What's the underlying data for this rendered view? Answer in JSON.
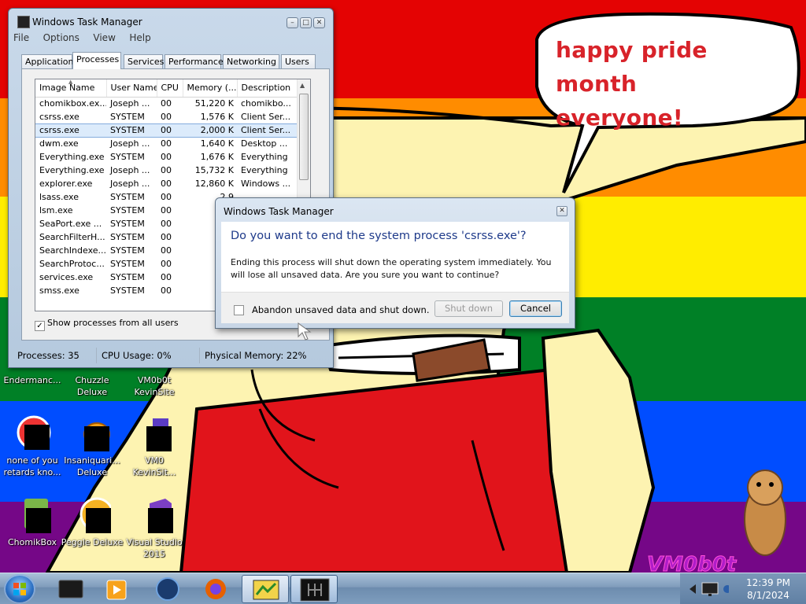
{
  "wallpaper": {
    "speech_bubble": [
      "happy pride month",
      "everyone!"
    ],
    "signature_logo": "VM0b0t",
    "stripe_colors": [
      "#e40303",
      "#ff8c00",
      "#ffed00",
      "#008026",
      "#004dff",
      "#750787"
    ]
  },
  "desktop_icons": [
    {
      "label": "Endermanc...",
      "icon": "app-icon"
    },
    {
      "label": "Chuzzle\nDeluxe",
      "icon": "chuzzle-icon"
    },
    {
      "label": "VM0b0t\nKevinSite",
      "icon": "app-icon"
    },
    {
      "label": "none of you\nretards kno...",
      "icon": "app-icon"
    },
    {
      "label": "Insaniquari...\nDeluxe",
      "icon": "insaniquarium-icon"
    },
    {
      "label": "VM0\nKevinSit...",
      "icon": "app-icon"
    },
    {
      "label": "ChomikBox",
      "icon": "chomikbox-icon"
    },
    {
      "label": "Peggle Deluxe",
      "icon": "peggle-icon"
    },
    {
      "label": "Visual Studio\n2015",
      "icon": "visual-studio-icon"
    }
  ],
  "task_manager": {
    "title": "Windows Task Manager",
    "menu": [
      "File",
      "Options",
      "View",
      "Help"
    ],
    "tabs": [
      "Applications",
      "Processes",
      "Services",
      "Performance",
      "Networking",
      "Users"
    ],
    "selected_tab": "Processes",
    "columns": [
      "Image Name",
      "User Name",
      "CPU",
      "Memory (...",
      "Description"
    ],
    "rows": [
      [
        "chomikbox.ex...",
        "Joseph ...",
        "00",
        "51,220 K",
        "chomikbo..."
      ],
      [
        "csrss.exe",
        "SYSTEM",
        "00",
        "1,576 K",
        "Client Ser..."
      ],
      [
        "csrss.exe",
        "SYSTEM",
        "00",
        "2,000 K",
        "Client Ser..."
      ],
      [
        "dwm.exe",
        "Joseph ...",
        "00",
        "1,640 K",
        "Desktop ..."
      ],
      [
        "Everything.exe",
        "SYSTEM",
        "00",
        "1,676 K",
        "Everything"
      ],
      [
        "Everything.exe",
        "Joseph ...",
        "00",
        "15,732 K",
        "Everything"
      ],
      [
        "explorer.exe",
        "Joseph ...",
        "00",
        "12,860 K",
        "Windows ..."
      ],
      [
        "lsass.exe",
        "SYSTEM",
        "00",
        "2,9",
        ""
      ],
      [
        "lsm.exe",
        "SYSTEM",
        "00",
        "1,7",
        ""
      ],
      [
        "SeaPort.exe ...",
        "SYSTEM",
        "00",
        "5,2",
        ""
      ],
      [
        "SearchFilterH...",
        "SYSTEM",
        "00",
        "2,6",
        ""
      ],
      [
        "SearchIndexe...",
        "SYSTEM",
        "00",
        "6,9",
        ""
      ],
      [
        "SearchProtoc...",
        "SYSTEM",
        "00",
        "2,3",
        ""
      ],
      [
        "services.exe",
        "SYSTEM",
        "00",
        "3,5",
        ""
      ],
      [
        "smss.exe",
        "SYSTEM",
        "00",
        "5",
        ""
      ]
    ],
    "selected_row": 2,
    "show_all_label": "Show processes from all users",
    "show_all_checked": true,
    "status": {
      "processes": "Processes: 35",
      "cpu": "CPU Usage: 0%",
      "memory": "Physical Memory: 22%"
    }
  },
  "dialog": {
    "title": "Windows Task Manager",
    "heading": "Do you want to end the system process 'csrss.exe'?",
    "message": "Ending this process will shut down the operating system immediately.  You will lose all unsaved data.  Are you sure you want to continue?",
    "checkbox_label": "Abandon unsaved data and shut down.",
    "checkbox_checked": false,
    "shutdown_label": "Shut down",
    "shutdown_enabled": false,
    "cancel_label": "Cancel"
  },
  "taskbar": {
    "pinned": [
      "start-orb",
      "terminal-icon",
      "media-player-icon",
      "globe-icon",
      "firefox-icon",
      "task-manager-icon",
      "window-icon"
    ],
    "active_item": "window-icon",
    "clock_time": "12:39 PM",
    "clock_date": "8/1/2024"
  }
}
